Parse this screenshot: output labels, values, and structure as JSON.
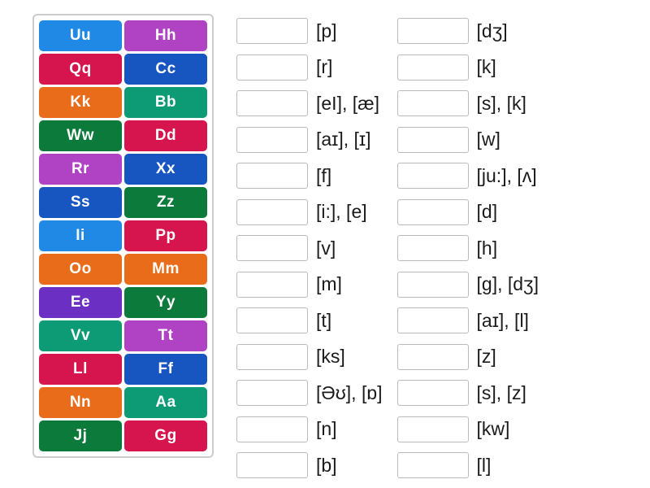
{
  "tiles": [
    {
      "label": "Uu",
      "color": "#2089e5"
    },
    {
      "label": "Hh",
      "color": "#b043c4"
    },
    {
      "label": "Qq",
      "color": "#d6144e"
    },
    {
      "label": "Cc",
      "color": "#1756c1"
    },
    {
      "label": "Kk",
      "color": "#e86c1a"
    },
    {
      "label": "Bb",
      "color": "#0d9b76"
    },
    {
      "label": "Ww",
      "color": "#0c7a3a"
    },
    {
      "label": "Dd",
      "color": "#d6144e"
    },
    {
      "label": "Rr",
      "color": "#b043c4"
    },
    {
      "label": "Xx",
      "color": "#1756c1"
    },
    {
      "label": "Ss",
      "color": "#1756c1"
    },
    {
      "label": "Zz",
      "color": "#0c7a3a"
    },
    {
      "label": "Ii",
      "color": "#2089e5"
    },
    {
      "label": "Pp",
      "color": "#d6144e"
    },
    {
      "label": "Oo",
      "color": "#e86c1a"
    },
    {
      "label": "Mm",
      "color": "#e86c1a"
    },
    {
      "label": "Ee",
      "color": "#6b2fc4"
    },
    {
      "label": "Yy",
      "color": "#0c7a3a"
    },
    {
      "label": "Vv",
      "color": "#0d9b76"
    },
    {
      "label": "Tt",
      "color": "#b043c4"
    },
    {
      "label": "Ll",
      "color": "#d6144e"
    },
    {
      "label": "Ff",
      "color": "#1756c1"
    },
    {
      "label": "Nn",
      "color": "#e86c1a"
    },
    {
      "label": "Aa",
      "color": "#0d9b76"
    },
    {
      "label": "Jj",
      "color": "#0c7a3a"
    },
    {
      "label": "Gg",
      "color": "#d6144e"
    }
  ],
  "targets": {
    "col1": [
      "[p]",
      "[r]",
      "[eI], [æ]",
      "[aɪ], [ɪ]",
      "[f]",
      "[i:], [e]",
      "[v]",
      "[m]",
      "[t]",
      "[ks]",
      "[Əʊ], [ɒ]",
      "[n]",
      "[b]"
    ],
    "col2": [
      "[dʒ]",
      "[k]",
      "[s], [k]",
      "[w]",
      "[ju:], [ʌ]",
      "[d]",
      "[h]",
      "[g], [dʒ]",
      "[aɪ], [l]",
      "[z]",
      "[s], [z]",
      "[kw]",
      "[l]"
    ]
  }
}
